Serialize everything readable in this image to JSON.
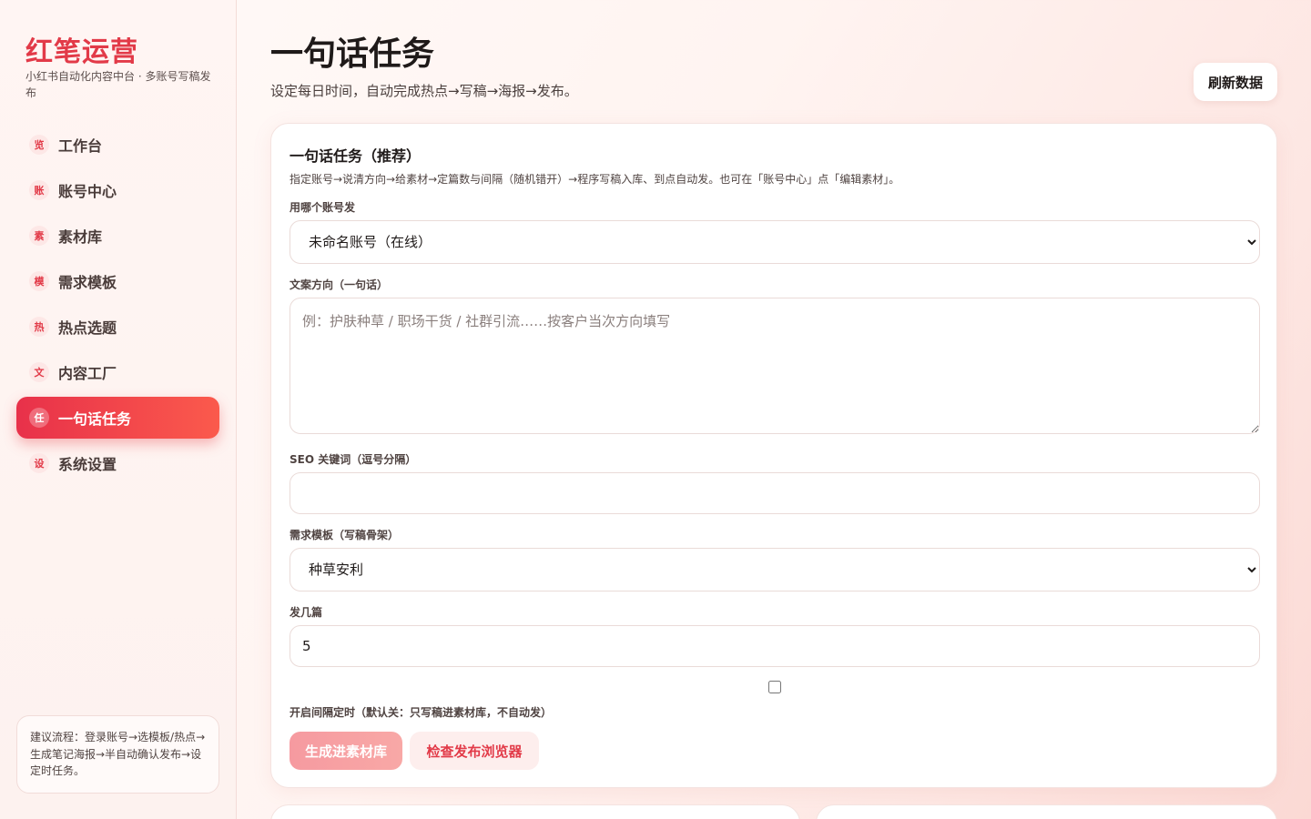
{
  "sidebar": {
    "brand": "红笔运营",
    "brand_sub": "小红书自动化内容中台 · 多账号写稿发布",
    "items": [
      {
        "badge": "览",
        "label": "工作台",
        "active": false
      },
      {
        "badge": "账",
        "label": "账号中心",
        "active": false
      },
      {
        "badge": "素",
        "label": "素材库",
        "active": false
      },
      {
        "badge": "模",
        "label": "需求模板",
        "active": false
      },
      {
        "badge": "热",
        "label": "热点选题",
        "active": false
      },
      {
        "badge": "文",
        "label": "内容工厂",
        "active": false
      },
      {
        "badge": "任",
        "label": "一句话任务",
        "active": true
      },
      {
        "badge": "设",
        "label": "系统设置",
        "active": false
      }
    ],
    "tip": "建议流程：登录账号→选模板/热点→生成笔记海报→半自动确认发布→设定时任务。"
  },
  "header": {
    "title": "一句话任务",
    "subtitle": "设定每日时间，自动完成热点→写稿→海报→发布。",
    "refresh_label": "刷新数据"
  },
  "card": {
    "title": "一句话任务（推荐）",
    "desc": "指定账号→说清方向→给素材→定篇数与间隔（随机错开）→程序写稿入库、到点自动发。也可在「账号中心」点「编辑素材」。",
    "account_label": "用哪个账号发",
    "account_value": "未命名账号（在线）",
    "direction_label": "文案方向（一句话）",
    "direction_placeholder": "例：护肤种草 / 职场干货 / 社群引流……按客户当次方向填写",
    "seo_label": "SEO 关键词（逗号分隔）",
    "seo_value": "",
    "template_label": "需求模板（写稿骨架）",
    "template_value": "种草安利",
    "count_label": "发几篇",
    "count_value": "5",
    "timer_label": "开启间隔定时（默认关：只写稿进素材库，不自动发）",
    "timer_checked": false,
    "generate_label": "生成进素材库",
    "check_browser_label": "检查发布浏览器"
  },
  "colors": {
    "accent": "#e23a48",
    "accent_gradient_start": "#e8314a",
    "accent_gradient_end": "#fb5a4c"
  }
}
